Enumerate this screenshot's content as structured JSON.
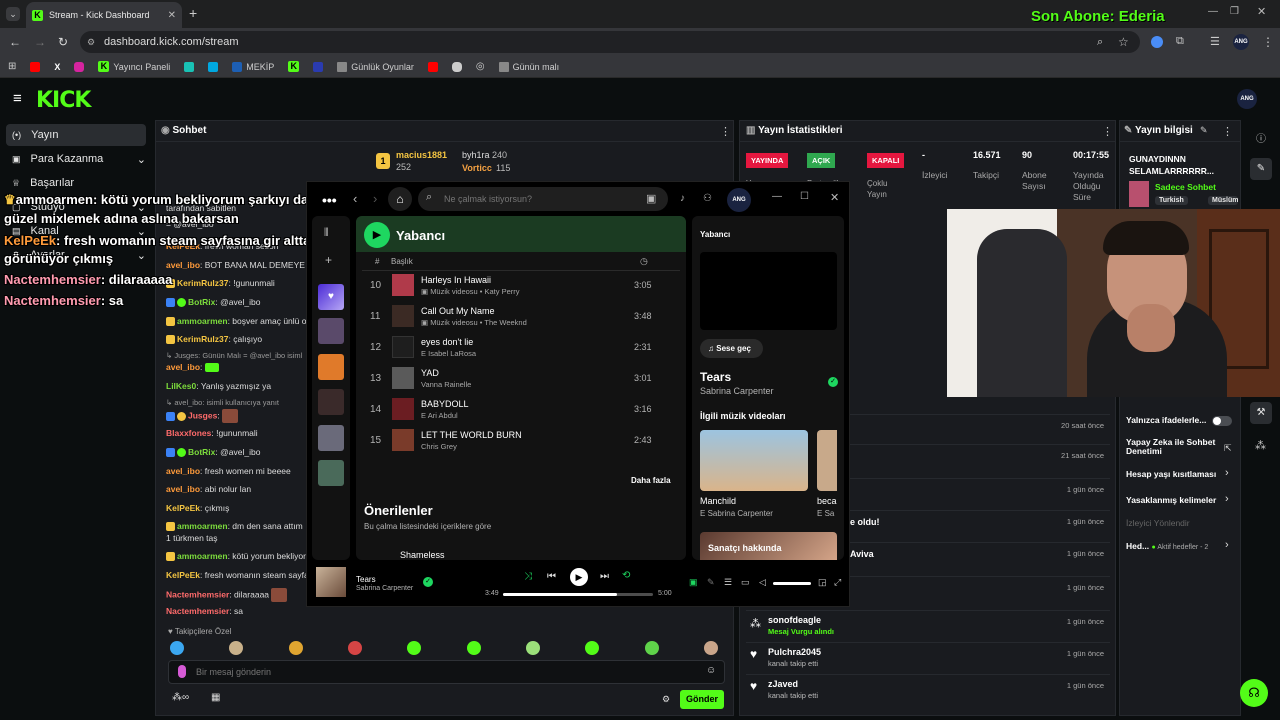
{
  "browser": {
    "tab_title": "Stream - Kick Dashboard",
    "url": "dashboard.kick.com/stream",
    "bookmarks": [
      "Yayıncı Paneli",
      "MEKİP",
      "Günlük Oyunlar",
      "Günün malı"
    ],
    "profile": "ANG"
  },
  "overlay": {
    "last_sub": "Son Abone: Ederia",
    "lines": [
      {
        "user": "ammoarmen",
        "text": ": kötü yorum bekliyorum şarkıyı daha",
        "color": "#f4c542"
      },
      {
        "user": "",
        "text": "güzel mixlemek adına aslına bakarsan",
        "color": "#fff"
      },
      {
        "user": "KelPeEk",
        "text": ": fresh womanın steam sayfasına gir altta",
        "color": "#ff9b3b"
      },
      {
        "user": "",
        "text": "görünüyor çıkmış",
        "color": "#fff"
      },
      {
        "user": "Nactemhemsier",
        "text": ": dilaraaaaa",
        "color": "#ff9bb0"
      },
      {
        "user": "Nactemhemsier",
        "text": ": sa",
        "color": "#ff9bb0"
      }
    ]
  },
  "sidebar": {
    "items": [
      {
        "label": "Yayın",
        "active": true
      },
      {
        "label": "Para Kazanma"
      },
      {
        "label": "Başarılar"
      },
      {
        "label": "Stüdyo"
      },
      {
        "label": "Kanal"
      },
      {
        "label": "Ayarlar"
      }
    ]
  },
  "chat": {
    "title": "Sohbet",
    "top_gifters": [
      {
        "rank": "1",
        "name": "macius1881",
        "count": "252"
      },
      {
        "name": "byh1ra",
        "count": "240"
      },
      {
        "name": "Vorticc",
        "count": "115"
      }
    ],
    "messages": [
      {
        "user": "",
        "text": "tarafından sabitlen"
      },
      {
        "user": "",
        "text": "= @avel_ibo"
      },
      {
        "user": "KelPeEk",
        "text": "fresh woman sezon"
      },
      {
        "user": "avel_ibo",
        "text": "BOT BANA MAL DEMEYE KO"
      },
      {
        "user": "KerimRulz37",
        "text": "!gununmali"
      },
      {
        "user": "BotRix",
        "text": "@avel_ibo"
      },
      {
        "user": "ammoarmen",
        "text": "boşver amaç ünlü o"
      },
      {
        "user": "KerimRulz37",
        "text": "çalışıyo"
      },
      {
        "user": "↳ Jusges",
        "text": "Günün Malı = @avel_ibo isiml"
      },
      {
        "user": "avel_ibo",
        "text": ""
      },
      {
        "user": "LilKes0",
        "text": "Yanlış yazmışız ya"
      },
      {
        "user": "↳ avel_ibo",
        "text": "isimli kullanıcıya yanıt"
      },
      {
        "user": "Jusges",
        "text": ""
      },
      {
        "user": "Blaxxfones",
        "text": "!gununmali"
      },
      {
        "user": "BotRix",
        "text": "@avel_ibo"
      },
      {
        "user": "avel_ibo",
        "text": "fresh women mi beeee"
      },
      {
        "user": "avel_ibo",
        "text": "abi nolur lan"
      },
      {
        "user": "KelPeEk",
        "text": "çıkmış"
      },
      {
        "user": "ammoarmen",
        "text": "dm den sana attım 1 türkmen taş"
      },
      {
        "user": "ammoarmen",
        "text": "kötü yorum bekliyor"
      },
      {
        "user": "KelPeEk",
        "text": "fresh womanın steam sayfas"
      },
      {
        "user": "Nactemhemsier",
        "text": "dilaraaaa"
      },
      {
        "user": "Nactemhemsier",
        "text": "sa"
      }
    ],
    "followers_only": "Takipçilere Özel",
    "input_placeholder": "Bir mesaj gönderin",
    "send_label": "Gönder"
  },
  "spotify": {
    "search_placeholder": "Ne çalmak istiyorsun?",
    "playlist_title": "Yabancı",
    "col_title": "Başlık",
    "tracks": [
      {
        "n": "10",
        "title": "Harleys In Hawaii",
        "sub": "Müzik videosu • Katy Perry",
        "dur": "3:05",
        "color": "#b03a4a"
      },
      {
        "n": "11",
        "title": "Call Out My Name",
        "sub": "Müzik videosu • The Weeknd",
        "dur": "3:48",
        "color": "#3b2a24"
      },
      {
        "n": "12",
        "title": "eyes don't lie",
        "sub": "Isabel LaRosa",
        "dur": "2:31",
        "color": "#1e1e1e"
      },
      {
        "n": "13",
        "title": "YAD",
        "sub": "Vanna Rainelle",
        "dur": "3:01",
        "color": "#5a5a5a"
      },
      {
        "n": "14",
        "title": "BABYDOLL",
        "sub": "Ari Abdul",
        "dur": "3:16",
        "color": "#6b1d22"
      },
      {
        "n": "15",
        "title": "LET THE WORLD BURN",
        "sub": "Chris Grey",
        "dur": "2:43",
        "color": "#7a3b2a"
      }
    ],
    "more_label": "Daha fazla",
    "recommended": "Önerilenler",
    "recommended_sub": "Bu çalma listesindeki içeriklere göre",
    "next_peek": "Shameless",
    "right_title": "Yabancı",
    "switch_audio": "Sese geç",
    "now_title": "Tears",
    "now_artist": "Sabrina Carpenter",
    "related_videos": "İlgili müzik videoları",
    "video1_title": "Manchild",
    "video1_artist": "Sabrina Carpenter",
    "video2_title": "beca",
    "video2_artist": "Sa",
    "about_artist": "Sanatçı hakkında",
    "player_title": "Tears",
    "player_artist": "Sabrina Carpenter",
    "time_elapsed": "3:49",
    "time_total": "5:00",
    "progress": 0.76
  },
  "stats": {
    "title": "Yayın İstatistikleri",
    "tags": [
      {
        "label": "YAYINDA",
        "color": "#e5173f",
        "caption": "Yayın"
      },
      {
        "label": "AÇIK",
        "color": "#2fa84f",
        "caption": "Partnerlik"
      },
      {
        "label": "KAPALI",
        "color": "#e5173f",
        "caption": "Çoklu Yayın"
      }
    ],
    "values": [
      {
        "value": "-",
        "label": "İzleyici"
      },
      {
        "value": "16.571",
        "label": "Takipçi"
      },
      {
        "value": "90",
        "label": "Abone Sayısı"
      },
      {
        "value": "00:17:55",
        "label": "Yayında Olduğu Süre"
      }
    ]
  },
  "activity": [
    {
      "name": "",
      "sub": "",
      "time": "20 saat önce"
    },
    {
      "name": "",
      "sub": "",
      "time": "21 saat önce"
    },
    {
      "name": "",
      "sub": "",
      "time": "1 gün önce"
    },
    {
      "name": "e oldu!",
      "sub": "",
      "time": "1 gün önce"
    },
    {
      "name": "Aviva",
      "sub": "",
      "time": "1 gün önce"
    },
    {
      "name": "",
      "sub": "",
      "time": "1 gün önce"
    },
    {
      "name": "sonofdeagle",
      "sub": "Mesaj Vurgu alındı",
      "time": "1 gün önce"
    },
    {
      "name": "Pulchra2045",
      "sub": "kanalı takip etti",
      "time": "1 gün önce"
    },
    {
      "name": "zJaved",
      "sub": "kanalı takip etti",
      "time": "1 gün önce"
    }
  ],
  "info": {
    "title": "Yayın bilgisi",
    "stream_title": "GUNAYDINNN SELAMLARRRRRR...",
    "chat_mode": "Sadece Sohbet",
    "tags": [
      "Turkish",
      "Müslüma"
    ],
    "options": [
      {
        "label": "Yalnızca ifadelerle...",
        "type": "toggle"
      },
      {
        "label": "Yapay Zeka ile Sohbet Denetimi",
        "type": "link"
      },
      {
        "label": "Hesap yaşı kısıtlaması",
        "type": "chev"
      },
      {
        "label": "Yasaklanmış kelimeler",
        "type": "chev"
      },
      {
        "label": "İzleyici Yönlendir",
        "type": "muted"
      },
      {
        "label": "Hed...",
        "type": "goal"
      }
    ],
    "goal_text": "Aktif hedefler - 2"
  },
  "colors": {
    "kick_green": "#53fc18",
    "spotify_green": "#1ed760",
    "live_red": "#e5173f"
  }
}
